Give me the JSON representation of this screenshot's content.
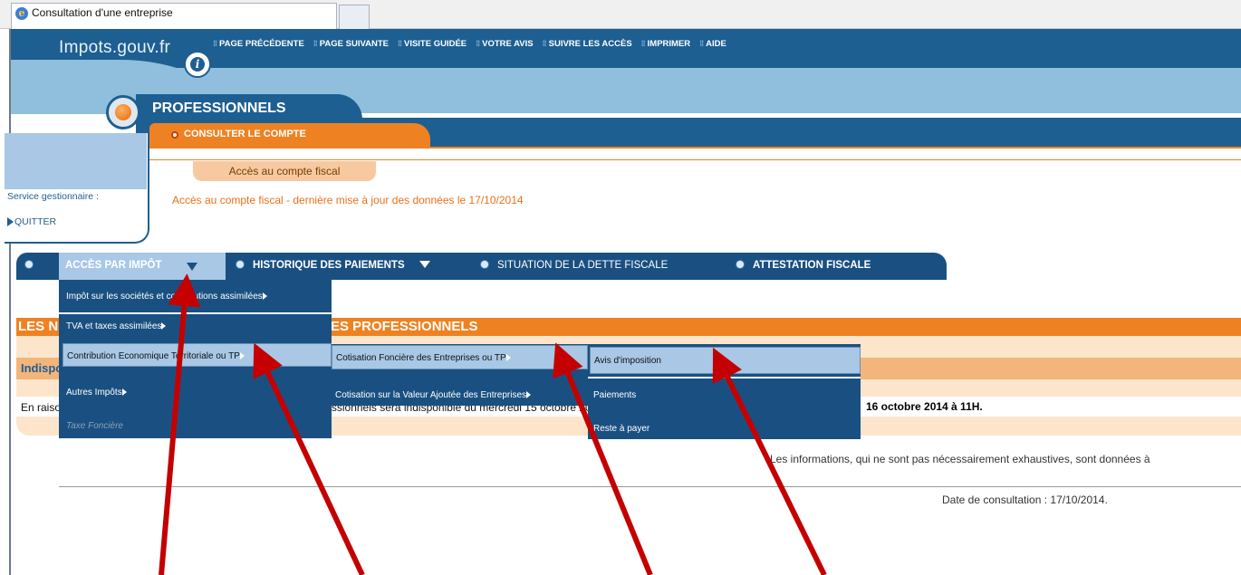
{
  "browser": {
    "tab_title": "Consultation d'une entreprise"
  },
  "header": {
    "logo_text": "Impots.gouv.fr",
    "logo_icon": "info-i-icon",
    "top_nav": [
      "PAGE PRÉCÉDENTE",
      "PAGE SUIVANTE",
      "VISITE GUIDÉE",
      "VOTRE AVIS",
      "SUIVRE LES ACCÈS",
      "IMPRIMER",
      "AIDE"
    ]
  },
  "section": {
    "title": "PROFESSIONNELS",
    "subtab": "CONSULTER LE COMPTE"
  },
  "side": {
    "service_label": "Service gestionnaire :",
    "quit_label": "QUITTER"
  },
  "fiscal": {
    "tab_label": "Accès au compte fiscal",
    "update_text": "Accès au compte fiscal - dernière mise à jour des données le 17/10/2014"
  },
  "mainnav": {
    "items": [
      "ACCÈS PAR IMPÔT",
      "HISTORIQUE DES PAIEMENTS",
      "SITUATION DE LA DETTE FISCALE",
      "ATTESTATION FISCALE"
    ]
  },
  "menu1": {
    "items": [
      "Impôt sur les sociétés et contributions assimilées",
      "TVA et taxes assimilées",
      "Contribution Economique Territoriale ou TP",
      "Autres Impôts",
      "Taxe Foncière"
    ]
  },
  "menu2": {
    "items": [
      "Cotisation Foncière des Entreprises ou TP",
      "Cotisation sur la Valeur Ajoutée des Entreprises"
    ]
  },
  "menu3": {
    "items": [
      "Avis d'imposition",
      "Paiements",
      "Reste à payer"
    ]
  },
  "banner": {
    "left": "LES N",
    "right": "ES PROFESSIONNELS"
  },
  "notice": {
    "title": "Indisponibilité du compte",
    "body_left": "En raison de travaux de maintenance, le compte fiscal des Professionnels sera indisponible du mercredi 15 octobre 2014 à 17h au jeudi ",
    "body_date": "16 octobre 2014 à 11H."
  },
  "footer": {
    "info": "Les informations, qui ne sont pas nécessairement exhaustives, sont données à",
    "consult_date": "Date de consultation : 17/10/2014."
  },
  "colors": {
    "navy": "#1a5081",
    "orange": "#ee8222",
    "light_blue": "#a8c8e6",
    "arrow_red": "#c40000"
  }
}
